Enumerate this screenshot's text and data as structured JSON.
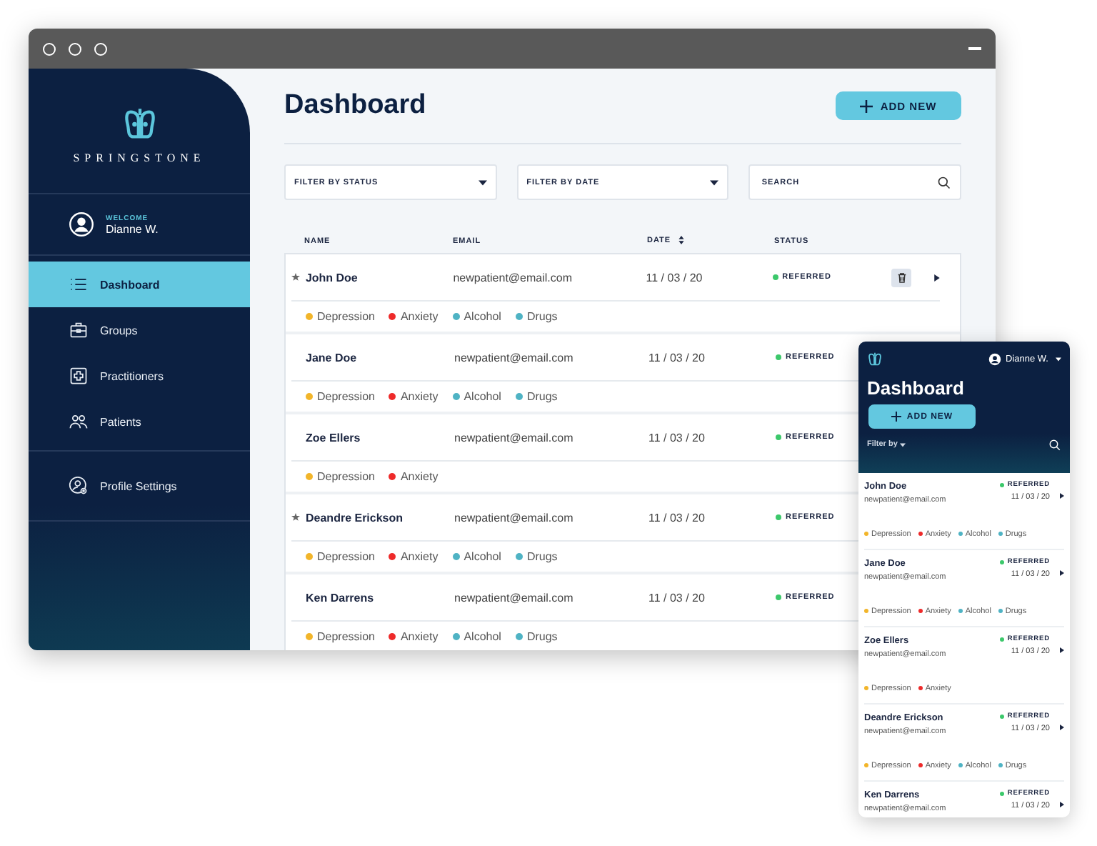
{
  "sidebar": {
    "brand": "SPRINGSTONE",
    "user": {
      "greeting": "WELCOME",
      "name": "Dianne W."
    },
    "nav": [
      {
        "label": "Dashboard",
        "kind": "list",
        "selected": true
      },
      {
        "label": "Groups",
        "kind": "briefcase",
        "selected": false
      },
      {
        "label": "Practitioners",
        "kind": "cross",
        "selected": false
      },
      {
        "label": "Patients",
        "kind": "people",
        "selected": false
      }
    ],
    "footer_nav": [
      {
        "label": "Profile Settings",
        "kind": "profile",
        "selected": false
      }
    ]
  },
  "main": {
    "title": "Dashboard",
    "add_button": "ADD NEW",
    "filters": [
      {
        "label": "FILTER BY STATUS"
      },
      {
        "label": "FILTER BY DATE"
      }
    ],
    "search": {
      "placeholder": "SEARCH"
    },
    "columns": [
      {
        "label": "NAME",
        "sortable": false
      },
      {
        "label": "EMAIL",
        "sortable": false
      },
      {
        "label": "DATE",
        "sortable": true
      },
      {
        "label": "STATUS",
        "sortable": false
      }
    ],
    "rows": [
      {
        "name": "John Doe",
        "email": "newpatient@email.com",
        "date": "11 / 03 / 20",
        "status": "REFERRED",
        "starred": true,
        "actions": true,
        "tags": [
          {
            "label": "Depression",
            "color": "#f2b52a"
          },
          {
            "label": "Anxiety",
            "color": "#ee2a2a"
          },
          {
            "label": "Alcohol",
            "color": "#4fb3c4"
          },
          {
            "label": "Drugs",
            "color": "#4fb3c4"
          }
        ]
      },
      {
        "name": "Jane Doe",
        "email": "newpatient@email.com",
        "date": "11 / 03 / 20",
        "status": "REFERRED",
        "starred": false,
        "actions": false,
        "tags": [
          {
            "label": "Depression",
            "color": "#f2b52a"
          },
          {
            "label": "Anxiety",
            "color": "#ee2a2a"
          },
          {
            "label": "Alcohol",
            "color": "#4fb3c4"
          },
          {
            "label": "Drugs",
            "color": "#4fb3c4"
          }
        ]
      },
      {
        "name": "Zoe Ellers",
        "email": "newpatient@email.com",
        "date": "11 / 03 / 20",
        "status": "REFERRED",
        "starred": false,
        "actions": false,
        "tags": [
          {
            "label": "Depression",
            "color": "#f2b52a"
          },
          {
            "label": "Anxiety",
            "color": "#ee2a2a"
          }
        ]
      },
      {
        "name": "Deandre Erickson",
        "email": "newpatient@email.com",
        "date": "11 / 03 / 20",
        "status": "REFERRED",
        "starred": true,
        "actions": false,
        "tags": [
          {
            "label": "Depression",
            "color": "#f2b52a"
          },
          {
            "label": "Anxiety",
            "color": "#ee2a2a"
          },
          {
            "label": "Alcohol",
            "color": "#4fb3c4"
          },
          {
            "label": "Drugs",
            "color": "#4fb3c4"
          }
        ]
      },
      {
        "name": "Ken Darrens",
        "email": "newpatient@email.com",
        "date": "11 / 03 / 20",
        "status": "REFERRED",
        "starred": false,
        "actions": false,
        "tags": [
          {
            "label": "Depression",
            "color": "#f2b52a"
          },
          {
            "label": "Anxiety",
            "color": "#ee2a2a"
          },
          {
            "label": "Alcohol",
            "color": "#4fb3c4"
          },
          {
            "label": "Drugs",
            "color": "#4fb3c4"
          }
        ]
      }
    ]
  },
  "mobile": {
    "user": "Dianne W.",
    "title": "Dashboard",
    "add_button": "ADD NEW",
    "filter": "Filter by",
    "rows": [
      {
        "name": "John Doe",
        "email": "newpatient@email.com",
        "date": "11 / 03 / 20",
        "status": "REFERRED",
        "tags": [
          {
            "label": "Depression",
            "color": "#f2b52a"
          },
          {
            "label": "Anxiety",
            "color": "#ee2a2a"
          },
          {
            "label": "Alcohol",
            "color": "#4fb3c4"
          },
          {
            "label": "Drugs",
            "color": "#4fb3c4"
          }
        ]
      },
      {
        "name": "Jane Doe",
        "email": "newpatient@email.com",
        "date": "11 / 03 / 20",
        "status": "REFERRED",
        "tags": [
          {
            "label": "Depression",
            "color": "#f2b52a"
          },
          {
            "label": "Anxiety",
            "color": "#ee2a2a"
          },
          {
            "label": "Alcohol",
            "color": "#4fb3c4"
          },
          {
            "label": "Drugs",
            "color": "#4fb3c4"
          }
        ]
      },
      {
        "name": "Zoe Ellers",
        "email": "newpatient@email.com",
        "date": "11 / 03 / 20",
        "status": "REFERRED",
        "tags": [
          {
            "label": "Depression",
            "color": "#f2b52a"
          },
          {
            "label": "Anxiety",
            "color": "#ee2a2a"
          }
        ]
      },
      {
        "name": "Deandre Erickson",
        "email": "newpatient@email.com",
        "date": "11 / 03 / 20",
        "status": "REFERRED",
        "tags": [
          {
            "label": "Depression",
            "color": "#f2b52a"
          },
          {
            "label": "Anxiety",
            "color": "#ee2a2a"
          },
          {
            "label": "Alcohol",
            "color": "#4fb3c4"
          },
          {
            "label": "Drugs",
            "color": "#4fb3c4"
          }
        ]
      },
      {
        "name": "Ken Darrens",
        "email": "newpatient@email.com",
        "date": "11 / 03 / 20",
        "status": "REFERRED"
      }
    ]
  }
}
